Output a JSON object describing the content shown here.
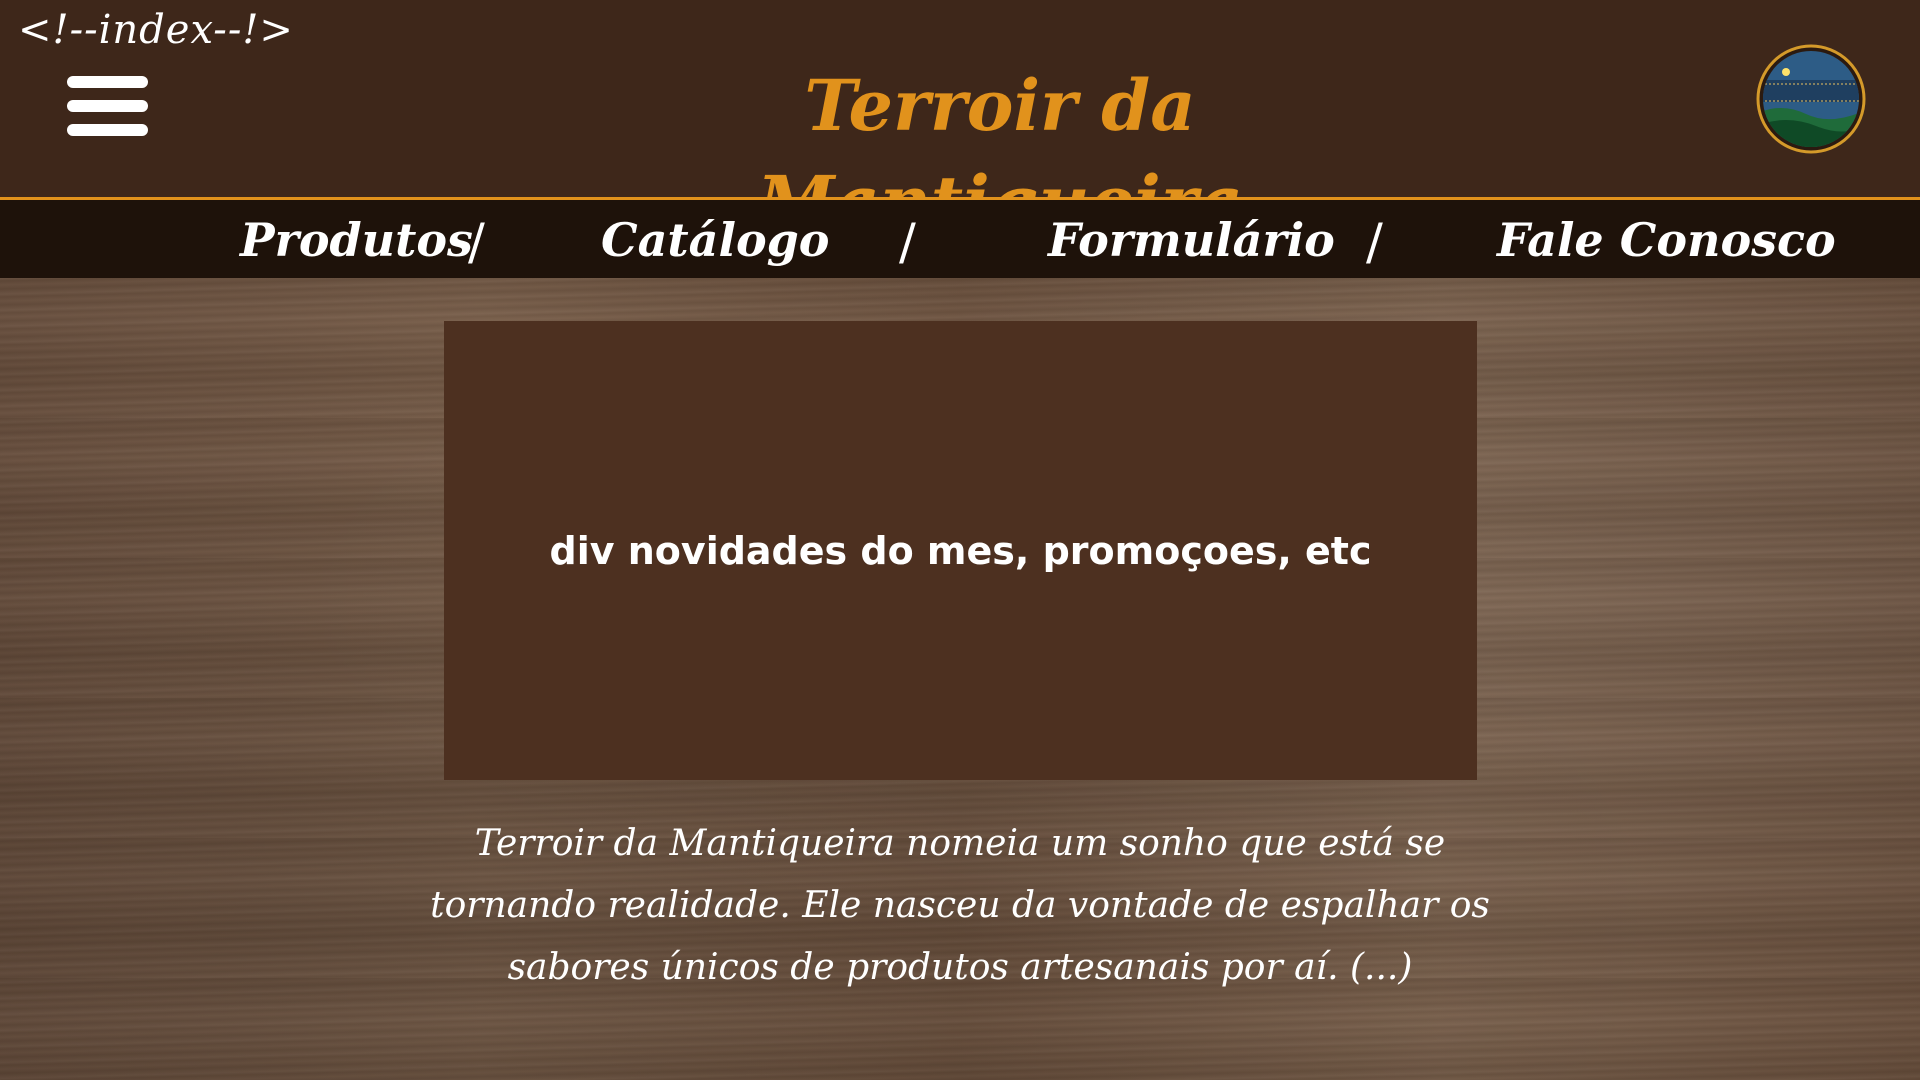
{
  "header": {
    "dev_comment": "<!--index--!>",
    "title": "Terroir da Mantiqueira",
    "menu_icon": "hamburger-menu-icon",
    "logo_icon": "terroir-logo-icon"
  },
  "nav": {
    "items": [
      {
        "label": "Produtos"
      },
      {
        "label": "Catálogo"
      },
      {
        "label": "Formulário"
      },
      {
        "label": "Fale Conosco"
      }
    ],
    "separator": "/"
  },
  "promo": {
    "text": "div novidades do mes, promoçoes, etc"
  },
  "intro": {
    "text": "Terroir da Mantiqueira nomeia um sonho que está se tornando realidade. Ele nasceu da vontade de espalhar os sabores únicos de produtos artesanais por aí. (...)"
  },
  "colors": {
    "accent": "#e1921c",
    "header_bg": "#3e271a",
    "nav_bg": "#1e120a",
    "promo_bg": "#4d3020"
  }
}
